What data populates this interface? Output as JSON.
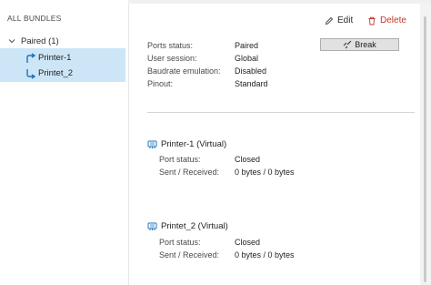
{
  "sidebar": {
    "header": "ALL BUNDLES",
    "group": {
      "label": "Paired (1)",
      "expanded": true
    },
    "items": [
      {
        "label": "Printer-1",
        "icon": "arrow-out-icon"
      },
      {
        "label": "Printet_2",
        "icon": "arrow-in-icon"
      }
    ]
  },
  "actions": {
    "edit": "Edit",
    "delete": "Delete"
  },
  "bundle": {
    "ports_status_label": "Ports status:",
    "ports_status_value": "Paired",
    "user_session_label": "User session:",
    "user_session_value": "Global",
    "baudrate_label": "Baudrate emulation:",
    "baudrate_value": "Disabled",
    "pinout_label": "Pinout:",
    "pinout_value": "Standard",
    "break_label": "Break"
  },
  "ports": [
    {
      "title": "Printer-1 (Virtual)",
      "status_label": "Port status:",
      "status_value": "Closed",
      "traffic_label": "Sent / Received:",
      "traffic_value": "0 bytes / 0 bytes"
    },
    {
      "title": "Printet_2 (Virtual)",
      "status_label": "Port status:",
      "status_value": "Closed",
      "traffic_label": "Sent / Received:",
      "traffic_value": "0 bytes / 0 bytes"
    }
  ],
  "colors": {
    "selection": "#cde6f7",
    "accent": "#1e73be",
    "delete": "#c0392b"
  }
}
